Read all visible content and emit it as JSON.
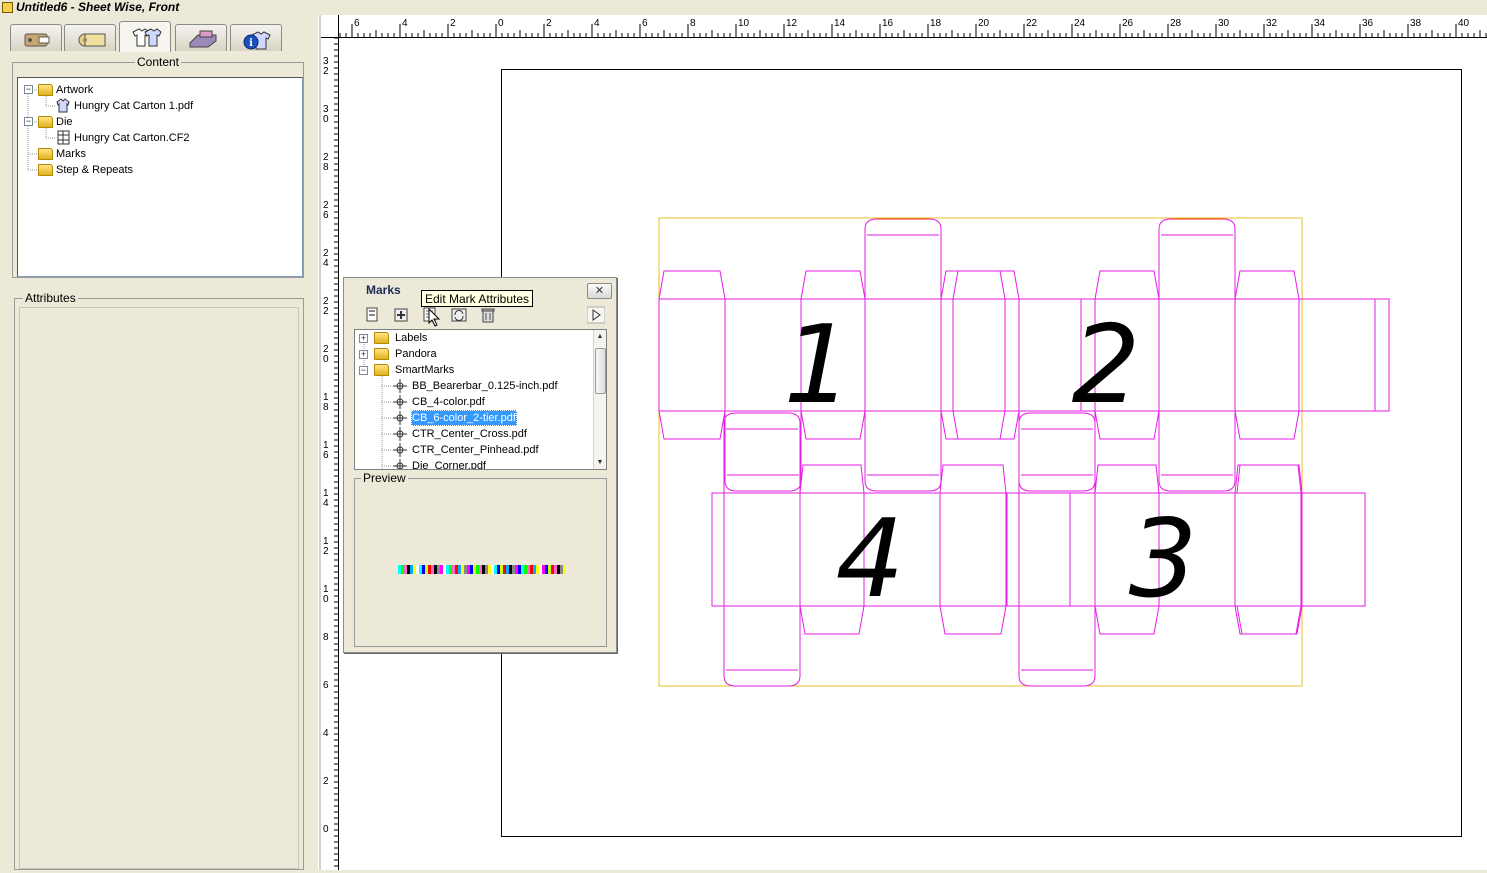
{
  "window": {
    "title": "Untitled6 - Sheet Wise, Front"
  },
  "left_panel": {
    "tabs": [
      "job-info-tab",
      "media-tab",
      "content-tab",
      "press-tab",
      "info-tab"
    ],
    "content_group_label": "Content",
    "content_tree": [
      {
        "label": "Artwork",
        "type": "folder",
        "expanded": true
      },
      {
        "label": "Hungry Cat Carton 1.pdf",
        "type": "artwork"
      },
      {
        "label": "Die",
        "type": "folder",
        "expanded": true
      },
      {
        "label": "Hungry Cat Carton.CF2",
        "type": "die"
      },
      {
        "label": "Marks",
        "type": "folder"
      },
      {
        "label": "Step & Repeats",
        "type": "folder"
      }
    ],
    "attributes_label": "Attributes"
  },
  "ruler_top": {
    "labels": [
      "6",
      "4",
      "2",
      "0",
      "2",
      "4",
      "6",
      "8",
      "10",
      "12",
      "14",
      "16",
      "18",
      "20",
      "22",
      "24",
      "26",
      "28",
      "30",
      "32",
      "34",
      "36",
      "38",
      "40"
    ]
  },
  "ruler_left": {
    "labels": [
      "3 2",
      "3 0",
      "2 8",
      "2 6",
      "2 4",
      "2 2",
      "2 0",
      "1 8",
      "1 6",
      "1 4",
      "1 2",
      "1 0",
      "8",
      "6",
      "4",
      "2",
      "0"
    ]
  },
  "marks_dialog": {
    "title": "Marks",
    "close_label": "✕",
    "tooltip": "Edit Mark Attributes",
    "items": [
      {
        "label": "Labels",
        "type": "folder"
      },
      {
        "label": "Pandora",
        "type": "folder"
      },
      {
        "label": "SmartMarks",
        "type": "folder"
      },
      {
        "label": "BB_Bearerbar_0.125-inch.pdf",
        "type": "mark"
      },
      {
        "label": "CB_4-color.pdf",
        "type": "mark"
      },
      {
        "label": "CB_6-color_2-tier.pdf",
        "type": "mark",
        "selected": true
      },
      {
        "label": "CTR_Center_Cross.pdf",
        "type": "mark"
      },
      {
        "label": "CTR_Center_Pinhead.pdf",
        "type": "mark"
      },
      {
        "label": "Die_Corner.pdf",
        "type": "mark"
      }
    ],
    "preview_label": "Preview"
  },
  "die_layout": {
    "numbers": [
      "1",
      "2",
      "4",
      "3"
    ],
    "die_color": "#e61ee6",
    "bleed_color": "#e8c020",
    "glue_color": "#ff2020"
  }
}
